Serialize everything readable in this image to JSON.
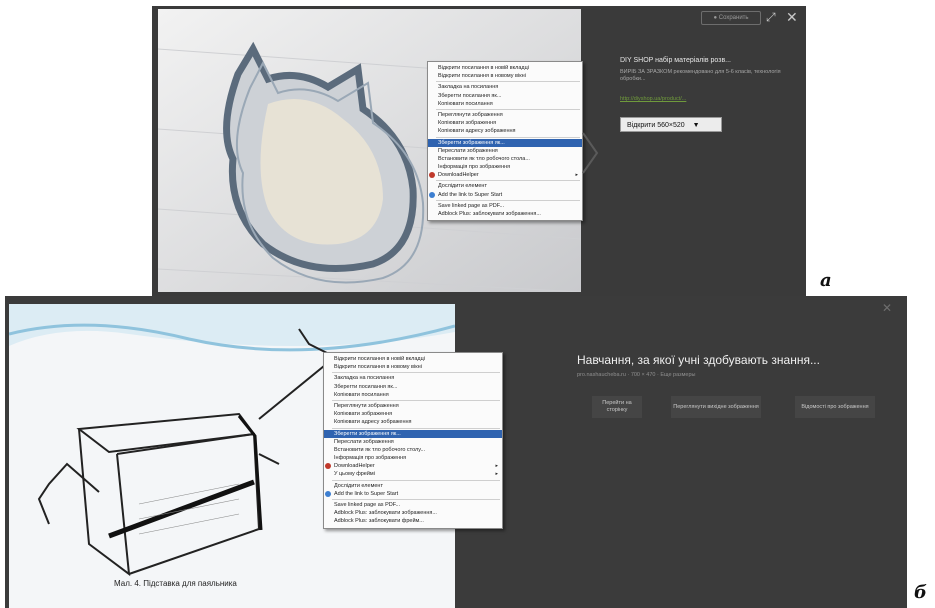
{
  "panel_a": {
    "save_button": "Сохранить",
    "title": "DIY SHOP набір матеріалів розв...",
    "description": "ВИРІБ ЗА ЗРАЗКОМ рекомендовано для 5-6 класів, технологія обробки...",
    "link": "http://diyshop.ua/product/...",
    "open_button": "Відкрити 560×520",
    "menu": [
      {
        "label": "Відкрити посилання в новій вкладці"
      },
      {
        "label": "Відкрити посилання в новому вікні"
      },
      {
        "sep": true
      },
      {
        "label": "Закладка на посилання"
      },
      {
        "label": "Зберегти посилання як..."
      },
      {
        "label": "Копіювати посилання"
      },
      {
        "sep": true
      },
      {
        "label": "Переглянути зображення"
      },
      {
        "label": "Копіювати зображення"
      },
      {
        "label": "Копіювати адресу зображення"
      },
      {
        "sep": true
      },
      {
        "label": "Зберегти зображення як...",
        "selected": true
      },
      {
        "label": "Переслати зображення"
      },
      {
        "label": "Встановити як тло робочого стола..."
      },
      {
        "label": "Інформація про зображення"
      },
      {
        "label": "DownloadHelper",
        "submenu": true,
        "icon": "#c0392b"
      },
      {
        "sep": true
      },
      {
        "label": "Дослідити елемент"
      },
      {
        "label": "Add the link to Super Start",
        "icon": "#3d7fd1"
      },
      {
        "sep": true
      },
      {
        "label": "Save linked page as PDF..."
      },
      {
        "label": "Adblock Plus: заблокувати зображення..."
      }
    ]
  },
  "panel_b": {
    "title": "Навчання, за якої учні здобувають знання...",
    "subtitle": "pro.nashaucheba.ru · 700 × 470 · Еще размеры",
    "caption": "Мал. 4. Підставка для паяльника",
    "buttons": [
      "Перейти на сторінку",
      "Переглянути вихідне зображення",
      "Відомості про зображення"
    ],
    "menu": [
      {
        "label": "Відкрити посилання в новій вкладці"
      },
      {
        "label": "Відкрити посилання в новому вікні"
      },
      {
        "sep": true
      },
      {
        "label": "Закладка на посилання"
      },
      {
        "label": "Зберегти посилання як..."
      },
      {
        "label": "Копіювати посилання"
      },
      {
        "sep": true
      },
      {
        "label": "Переглянути зображення"
      },
      {
        "label": "Копіювати зображення"
      },
      {
        "label": "Копіювати адресу зображення"
      },
      {
        "sep": true
      },
      {
        "label": "Зберегти зображення як...",
        "selected": true
      },
      {
        "label": "Переслати зображення"
      },
      {
        "label": "Встановити як тло робочого столу..."
      },
      {
        "label": "Інформація про зображення"
      },
      {
        "label": "DownloadHelper",
        "submenu": true,
        "icon": "#c0392b"
      },
      {
        "label": "У цьому фреймі",
        "submenu": true
      },
      {
        "sep": true
      },
      {
        "label": "Дослідити елемент"
      },
      {
        "label": "Add the link to Super Start",
        "icon": "#3d7fd1"
      },
      {
        "sep": true
      },
      {
        "label": "Save linked page as PDF..."
      },
      {
        "label": "Adblock Plus: заблокувати зображення..."
      },
      {
        "label": "Adblock Plus: заблокувати фрейм..."
      }
    ]
  },
  "labels": {
    "a": "а",
    "b": "б"
  }
}
